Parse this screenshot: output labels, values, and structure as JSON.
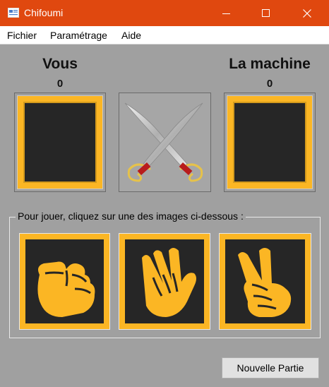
{
  "window": {
    "title": "Chifoumi"
  },
  "menu": {
    "items": [
      "Fichier",
      "Paramétrage",
      "Aide"
    ]
  },
  "players": {
    "you": {
      "label": "Vous",
      "score": "0"
    },
    "machine": {
      "label": "La machine",
      "score": "0"
    }
  },
  "instructions": "Pour jouer, cliquez sur une des images ci-dessous :",
  "choices": [
    "rock-hand-icon",
    "paper-hand-icon",
    "scissors-hand-icon"
  ],
  "buttons": {
    "new_game": "Nouvelle Partie"
  },
  "colors": {
    "titlebar": "#e0480f",
    "background": "#a0a0a0",
    "accent": "#fbb624",
    "tile": "#262626"
  }
}
